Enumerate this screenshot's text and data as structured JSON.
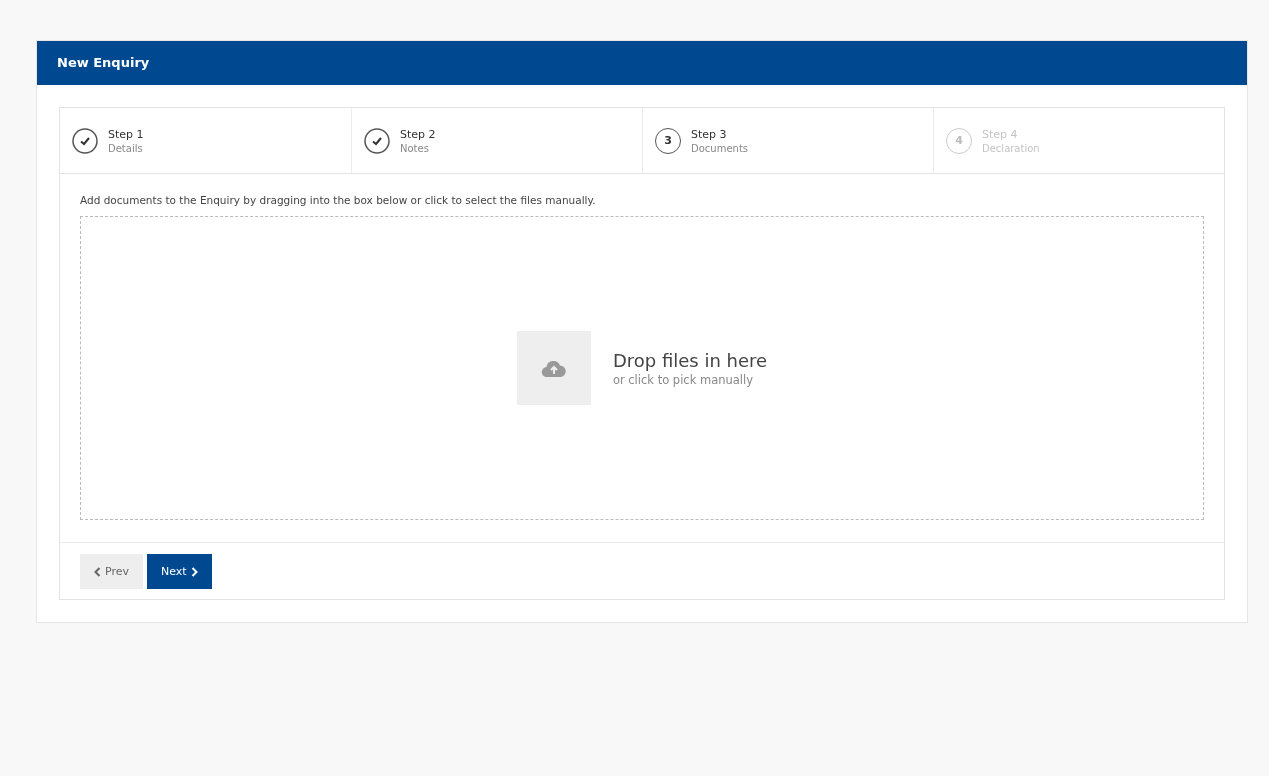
{
  "panel": {
    "title": "New Enquiry"
  },
  "steps": [
    {
      "kind": "done",
      "title": "Step 1",
      "subtitle": "Details"
    },
    {
      "kind": "done",
      "title": "Step 2",
      "subtitle": "Notes"
    },
    {
      "kind": "current",
      "number": "3",
      "title": "Step 3",
      "subtitle": "Documents"
    },
    {
      "kind": "upcoming",
      "number": "4",
      "title": "Step 4",
      "subtitle": "Declaration"
    }
  ],
  "instructions": "Add documents to the Enquiry by dragging into the box below or click to select the files manually.",
  "dropzone": {
    "title": "Drop files in here",
    "subtitle": "or click to pick manually"
  },
  "buttons": [
    {
      "kind": "secondary",
      "label": "Prev"
    },
    {
      "kind": "primary",
      "label": "Next"
    }
  ]
}
